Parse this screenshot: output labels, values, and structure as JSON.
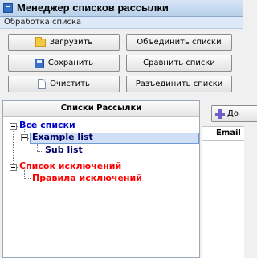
{
  "window": {
    "title": "Менеджер списков рассылки",
    "icon": "app-icon"
  },
  "group": {
    "title": "Обработка списка"
  },
  "buttons": {
    "load": {
      "label": "Загрузить",
      "icon": "folder-icon"
    },
    "save": {
      "label": "Сохранить",
      "icon": "disk-icon"
    },
    "clear": {
      "label": "Очистить",
      "icon": "page-icon"
    },
    "merge": {
      "label": "Объединить списки"
    },
    "compare": {
      "label": "Сравнить списки"
    },
    "split": {
      "label": "Разъединить списки"
    }
  },
  "tree": {
    "header": "Списки Рассылки",
    "nodes": [
      {
        "label": "Все списки",
        "color": "#0000cc"
      },
      {
        "label": "Example list",
        "color": "#000066",
        "selected": true
      },
      {
        "label": "Sub list",
        "color": "#000066"
      },
      {
        "label": "Список исключений",
        "color": "#ff0000"
      },
      {
        "label": "Правила исключений",
        "color": "#ff0000"
      }
    ]
  },
  "right": {
    "add_button_label": "До",
    "add_icon": "plus-icon",
    "column_header": "Email"
  }
}
